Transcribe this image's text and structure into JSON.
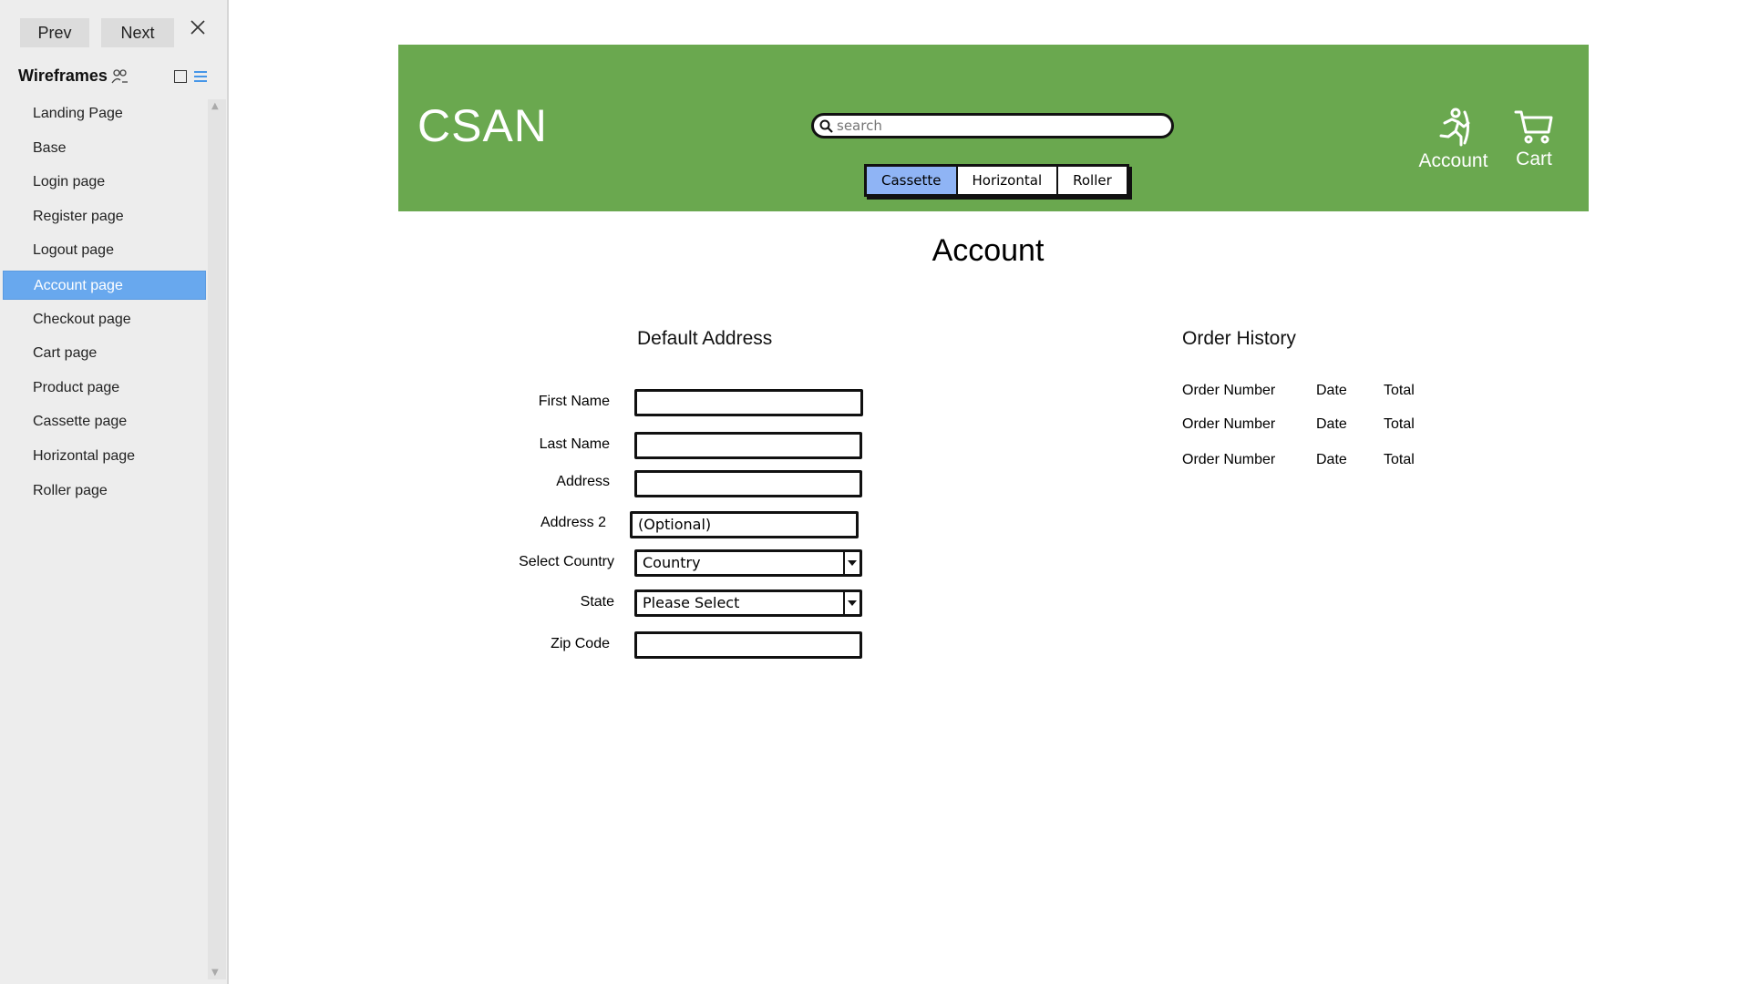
{
  "toolbar": {
    "prev_label": "Prev",
    "next_label": "Next"
  },
  "sidebar": {
    "title": "Wireframes",
    "items": [
      {
        "label": "Landing Page"
      },
      {
        "label": "Base"
      },
      {
        "label": "Login page"
      },
      {
        "label": "Register page"
      },
      {
        "label": "Logout page"
      },
      {
        "label": "Account page"
      },
      {
        "label": "Checkout page"
      },
      {
        "label": "Cart page"
      },
      {
        "label": "Product page"
      },
      {
        "label": "Cassette page"
      },
      {
        "label": "Horizontal page"
      },
      {
        "label": "Roller page"
      }
    ],
    "active_item": "Account page"
  },
  "header": {
    "logo": "CSAN",
    "search_placeholder": "search",
    "categories": [
      "Cassette",
      "Horizontal",
      "Roller"
    ],
    "selected_category": "Cassette",
    "account_label": "Account",
    "cart_label": "Cart"
  },
  "page": {
    "title": "Account",
    "default_address": {
      "heading": "Default Address",
      "fields": {
        "first_name": {
          "label": "First Name",
          "value": ""
        },
        "last_name": {
          "label": "Last Name",
          "value": ""
        },
        "address": {
          "label": "Address",
          "value": ""
        },
        "address2": {
          "label": "Address 2",
          "value": "(Optional)"
        },
        "country": {
          "label": "Select Country",
          "value": "Country"
        },
        "state": {
          "label": "State",
          "value": "Please Select"
        },
        "zip": {
          "label": "Zip Code",
          "value": ""
        }
      }
    },
    "order_history": {
      "heading": "Order History",
      "rows": [
        [
          "Order Number",
          "Date",
          "Total"
        ],
        [
          "Order Number",
          "Date",
          "Total"
        ],
        [
          "Order Number",
          "Date",
          "Total"
        ]
      ]
    }
  },
  "colors": {
    "header_bg": "#6aa84f",
    "selected_category": "#8fb4f5",
    "sidebar_active": "#68a8ee"
  },
  "icons": [
    "close-icon",
    "people-icon",
    "square-view-icon",
    "list-view-icon",
    "search-icon",
    "account-runner-icon",
    "cart-icon"
  ]
}
